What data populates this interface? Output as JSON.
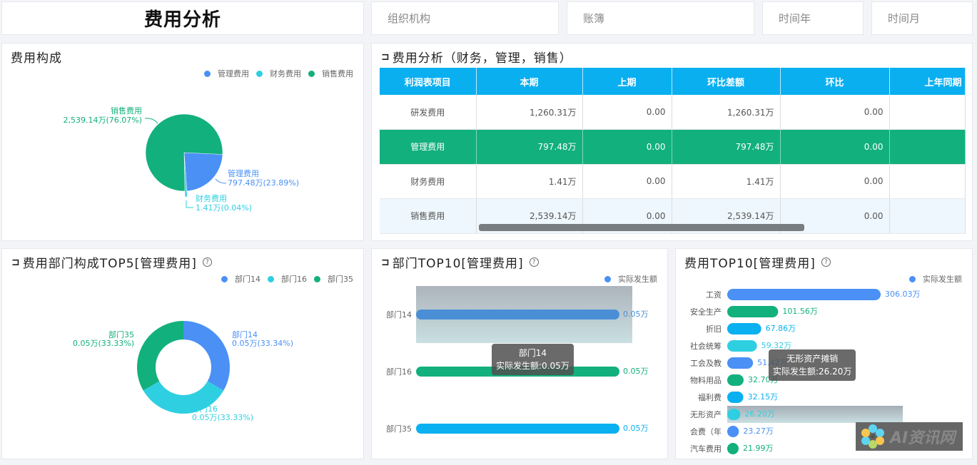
{
  "header": {
    "title": "费用分析",
    "filters": [
      {
        "label": "组织机构"
      },
      {
        "label": "账簿"
      },
      {
        "label": "时间年"
      },
      {
        "label": "时间月"
      }
    ]
  },
  "colors": {
    "blue": "#4a90f5",
    "cyan": "#2fcfe2",
    "green": "#12b07c",
    "sky": "#0ab0f0",
    "header": "#0aaff0"
  },
  "pie_panel": {
    "title": "费用构成",
    "legend": [
      "管理费用",
      "财务费用",
      "销售费用"
    ]
  },
  "table_panel": {
    "title": "费用分析（财务，管理，销售）",
    "columns": [
      "利润表项目",
      "本期",
      "上期",
      "环比差额",
      "环比",
      "上年同期"
    ],
    "rows": [
      {
        "cells": [
          "研发费用",
          "1,260.31万",
          "0.00",
          "1,260.31万",
          "0.00",
          ""
        ]
      },
      {
        "cells": [
          "管理费用",
          "797.48万",
          "0.00",
          "797.48万",
          "0.00",
          ""
        ]
      },
      {
        "cells": [
          "财务费用",
          "1.41万",
          "0.00",
          "1.41万",
          "0.00",
          ""
        ]
      },
      {
        "cells": [
          "销售费用",
          "2,539.14万",
          "0.00",
          "2,539.14万",
          "0.00",
          ""
        ]
      }
    ],
    "selected_row": 1
  },
  "donut_panel": {
    "title": "费用部门构成TOP5[管理费用]",
    "help": "?",
    "legend": [
      "部门14",
      "部门16",
      "部门35"
    ]
  },
  "dept_panel": {
    "title": "部门TOP10[管理费用]",
    "help": "?",
    "legend": "实际发生额",
    "tooltip": {
      "name": "部门14",
      "line": "实际发生额:0.05万"
    }
  },
  "cost_panel": {
    "title": "费用TOP10[管理费用]",
    "help": "?",
    "legend": "实际发生额",
    "tooltip": {
      "name": "无形资产摊销",
      "line": "实际发生额:26.20万"
    }
  },
  "watermark": {
    "text": "AI资讯网"
  },
  "chart_data": [
    {
      "type": "pie",
      "title": "费用构成",
      "unit": "万",
      "legend_position": "top-right",
      "slices": [
        {
          "name": "管理费用",
          "value": 797.48,
          "value_label": "797.48万",
          "percent": 23.89,
          "percent_label": "23.89%",
          "color": "#4a90f5"
        },
        {
          "name": "财务费用",
          "value": 1.41,
          "value_label": "1.41万",
          "percent": 0.04,
          "percent_label": "0.04%",
          "color": "#2fcfe2"
        },
        {
          "name": "销售费用",
          "value": 2539.14,
          "value_label": "2,539.14万",
          "percent": 76.07,
          "percent_label": "76.07%",
          "color": "#12b07c"
        }
      ]
    },
    {
      "type": "pie",
      "donut": true,
      "title": "费用部门构成TOP5[管理费用]",
      "unit": "万",
      "legend_position": "top-right",
      "slices": [
        {
          "name": "部门14",
          "value": 0.05,
          "value_label": "0.05万",
          "percent": 33.34,
          "percent_label": "33.34%",
          "color": "#4a90f5"
        },
        {
          "name": "部门16",
          "value": 0.05,
          "value_label": "0.05万",
          "percent": 33.33,
          "percent_label": "33.33%",
          "color": "#2fcfe2"
        },
        {
          "name": "部门35",
          "value": 0.05,
          "value_label": "0.05万",
          "percent": 33.33,
          "percent_label": "33.33%",
          "color": "#12b07c"
        }
      ]
    },
    {
      "type": "bar",
      "orientation": "horizontal",
      "title": "部门TOP10[管理费用]",
      "series_name": "实际发生额",
      "categories": [
        "部门14",
        "部门16",
        "部门35"
      ],
      "values": [
        0.05,
        0.05,
        0.05
      ],
      "labels": [
        "0.05万",
        "0.05万",
        "0.05万"
      ],
      "colors": [
        "#4a8fd6",
        "#12b07c",
        "#0ab0f0"
      ],
      "highlighted": 0,
      "xlim": [
        0,
        0.05
      ]
    },
    {
      "type": "bar",
      "orientation": "horizontal",
      "title": "费用TOP10[管理费用]",
      "series_name": "实际发生额",
      "categories": [
        "工资",
        "安全生产",
        "折旧",
        "社会统筹",
        "工会及教",
        "物料用品",
        "福利费",
        "无形资产",
        "会费（年",
        "汽车费用"
      ],
      "values": [
        306.03,
        101.56,
        67.86,
        59.32,
        51.42,
        32.7,
        32.15,
        26.2,
        23.27,
        21.99
      ],
      "labels": [
        "306.03万",
        "101.56万",
        "67.86万",
        "59.32万",
        "51.42万",
        "32.70万",
        "32.15万",
        "26.20万",
        "23.27万",
        "21.99万"
      ],
      "colors": [
        "#4a90f5",
        "#12b07c",
        "#0ab0f0",
        "#2fcfe2",
        "#4a90f5",
        "#12b07c",
        "#0ab0f0",
        "#2fcfe2",
        "#4a90f5",
        "#12b07c"
      ],
      "highlighted": 7,
      "xlim": [
        0,
        306.03
      ]
    }
  ]
}
